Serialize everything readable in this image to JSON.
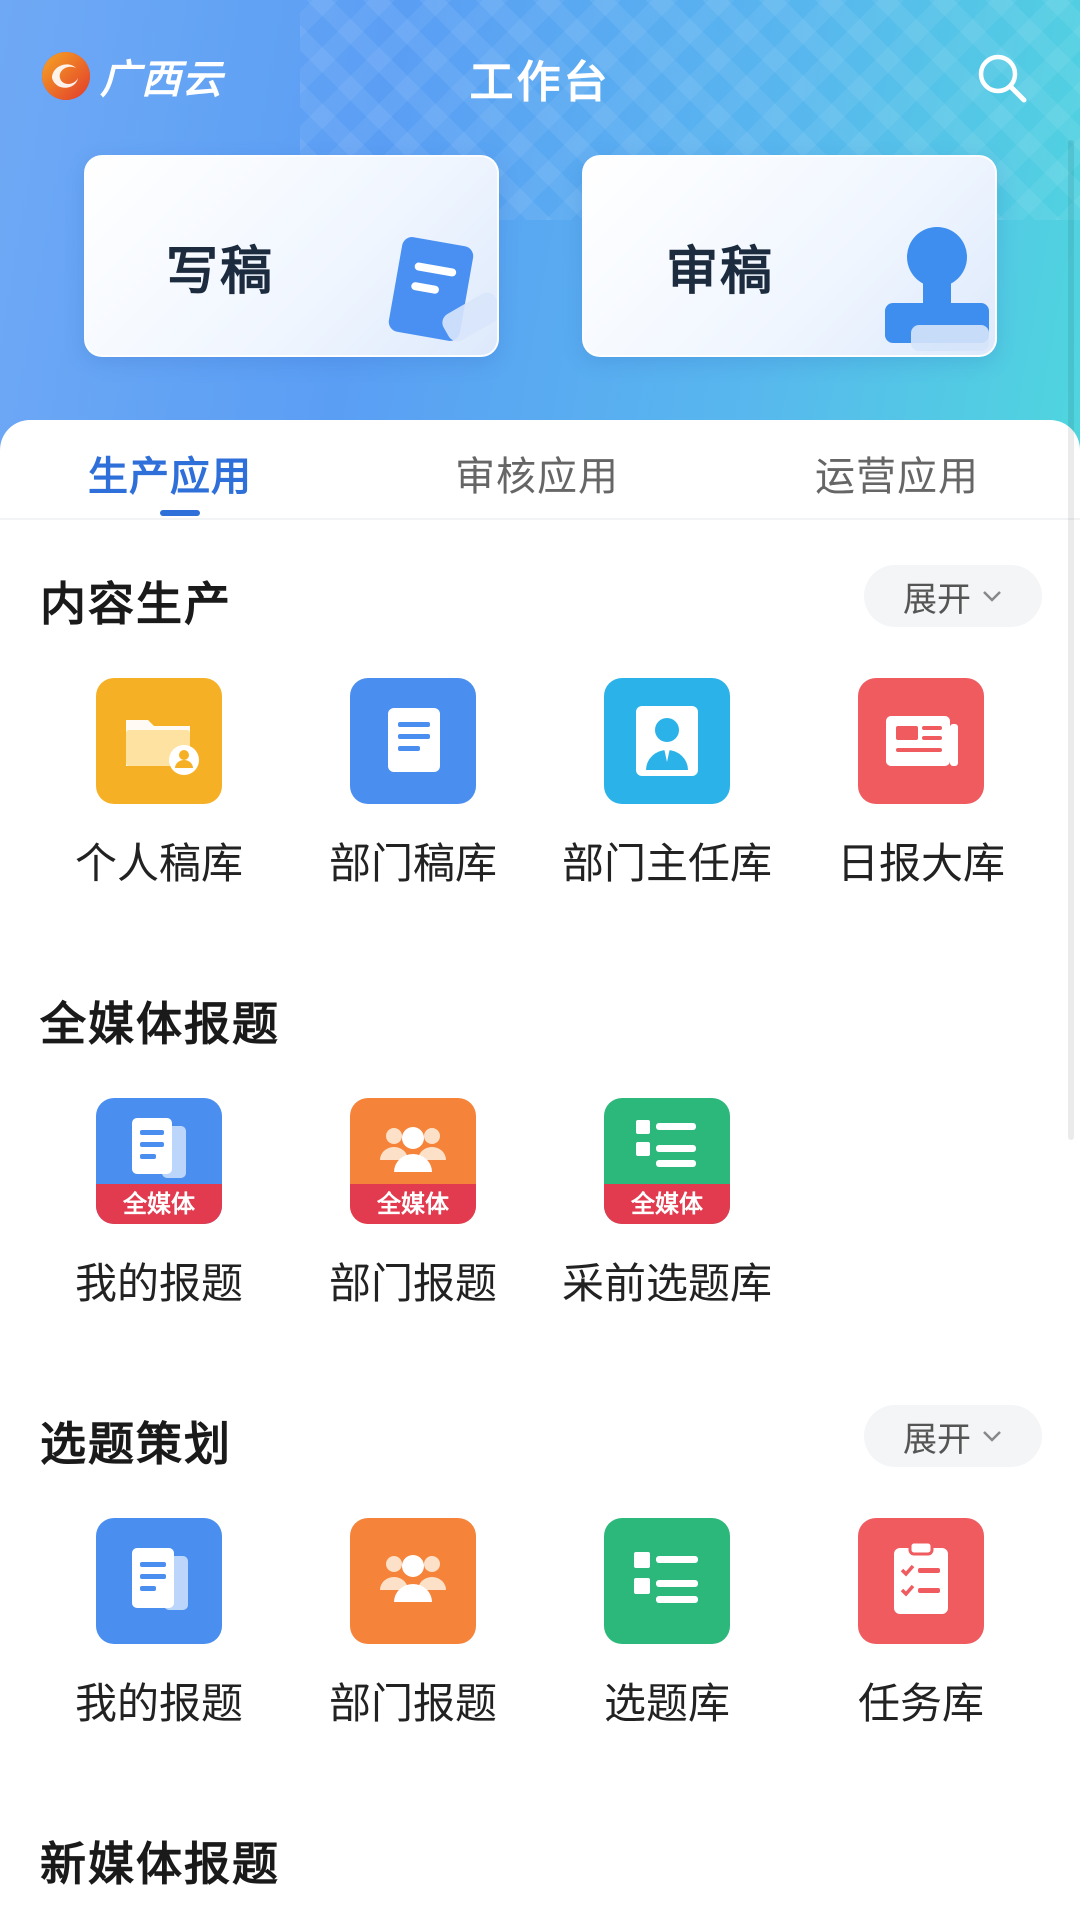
{
  "header": {
    "logo_text": "广西云",
    "title": "工作台",
    "search_icon": "search-icon"
  },
  "quick_actions": [
    {
      "label": "写稿",
      "icon": "document-pen-icon"
    },
    {
      "label": "审稿",
      "icon": "stamp-icon"
    }
  ],
  "tabs": [
    {
      "label": "生产应用",
      "active": true
    },
    {
      "label": "审核应用",
      "active": false
    },
    {
      "label": "运营应用",
      "active": false
    }
  ],
  "sections": [
    {
      "title": "内容生产",
      "expand_label": "展开",
      "items": [
        {
          "label": "个人稿库",
          "icon": "personal-folder-icon",
          "color": "#f6b026"
        },
        {
          "label": "部门稿库",
          "icon": "document-icon",
          "color": "#4a8ef0"
        },
        {
          "label": "部门主任库",
          "icon": "person-icon",
          "color": "#2bb2e8"
        },
        {
          "label": "日报大库",
          "icon": "newspaper-icon",
          "color": "#ef5b5f"
        }
      ]
    },
    {
      "title": "全媒体报题",
      "items": [
        {
          "label": "我的报题",
          "icon": "report-doc-icon",
          "color": "#4a8ef0",
          "badge": "全媒体"
        },
        {
          "label": "部门报题",
          "icon": "group-icon",
          "color": "#f5843a",
          "badge": "全媒体"
        },
        {
          "label": "采前选题库",
          "icon": "list-icon",
          "color": "#2cb87a",
          "badge": "全媒体"
        }
      ]
    },
    {
      "title": "选题策划",
      "expand_label": "展开",
      "items": [
        {
          "label": "我的报题",
          "icon": "report-doc-icon",
          "color": "#4a8ef0"
        },
        {
          "label": "部门报题",
          "icon": "group-icon",
          "color": "#f5843a"
        },
        {
          "label": "选题库",
          "icon": "list-icon",
          "color": "#2cb87a"
        },
        {
          "label": "任务库",
          "icon": "clipboard-checklist-icon",
          "color": "#ef5b5f"
        }
      ]
    },
    {
      "title": "新媒体报题"
    }
  ],
  "colors": {
    "accent": "#2f6fd9",
    "badge_red": "#e23a4e"
  }
}
